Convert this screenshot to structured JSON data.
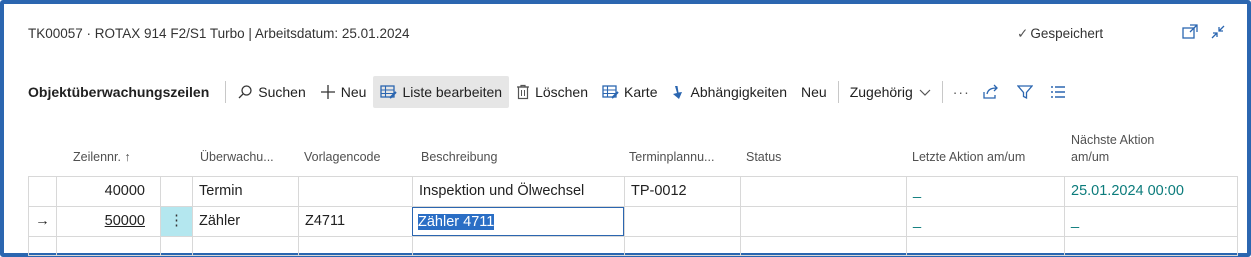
{
  "header": {
    "title": "TK00057 · ROTAX 914 F2/S1 Turbo | Arbeitsdatum: 25.01.2024",
    "saved_status": "Gespeichert",
    "icons": [
      "open-in-new-window-icon",
      "collapse-icon"
    ]
  },
  "toolbar": {
    "title": "Objektüberwachungszeilen",
    "search": "Suchen",
    "new": "Neu",
    "edit_list": "Liste bearbeiten",
    "delete": "Löschen",
    "card": "Karte",
    "dependencies": "Abhängigkeiten",
    "new2": "Neu",
    "related": "Zugehörig",
    "more": "···"
  },
  "columns": {
    "line_no": "Zeilennr. ↑",
    "monitoring": "Überwachu...",
    "template_code": "Vorlagencode",
    "description": "Beschreibung",
    "scheduling": "Terminplannu...",
    "status": "Status",
    "last_action": "Letzte Aktion am/um",
    "next_action_1": "Nächste Aktion",
    "next_action_2": "am/um"
  },
  "rows": [
    {
      "line_no": "40000",
      "monitoring": "Termin",
      "template_code": "",
      "description": "Inspektion und Ölwechsel",
      "scheduling": "TP-0012",
      "status": "",
      "last_action": "_",
      "next_action": "25.01.2024 00:00"
    },
    {
      "line_no": "50000",
      "row_marker": "→",
      "row_menu": "⋮",
      "monitoring": "Zähler",
      "template_code": "Z4711",
      "description": "Zähler 4711",
      "scheduling": "",
      "status": "",
      "last_action": "_",
      "next_action": "_"
    }
  ],
  "colors": {
    "frame": "#2b66b0",
    "link": "#0b7b7b",
    "selection": "#2a6ec5",
    "row_menu_bg": "#b4e7ef"
  }
}
